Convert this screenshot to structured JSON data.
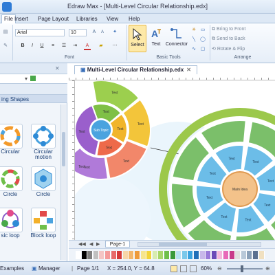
{
  "window": {
    "title": "Edraw Max - [Multi-Level Circular Relationship.edx]"
  },
  "tabs": [
    "File",
    "Insert",
    "Page Layout",
    "Libraries",
    "View",
    "Help"
  ],
  "ribbon": {
    "font_name": "Arial",
    "font_size": "10",
    "groups": {
      "font": "Font",
      "basic_tools": "Basic Tools",
      "arrange": "Arrange"
    },
    "tools": {
      "select": "Select",
      "text": "Text",
      "connector": "Connector"
    },
    "arrange_items": [
      "Bring to Front",
      "Send to Back",
      "Rotate & Flip"
    ],
    "font_buttons": [
      "B",
      "I",
      "U",
      "A"
    ]
  },
  "left_panel": {
    "section_title": "ing Shapes",
    "shapes": [
      "Circular",
      "Circular motion",
      "Circle",
      "Circle",
      "sic loop",
      "Block loop"
    ]
  },
  "document": {
    "tab_title": "Multi-Level Circular Relationship.edx",
    "page_tab": "Page-1"
  },
  "diagram_left": {
    "center_label": "Sub Topic",
    "sector_labels": [
      "Text",
      "Text",
      "Text",
      "Text",
      "Text",
      "Text",
      "Text",
      "Text",
      "Text"
    ]
  },
  "diagram_right": {
    "center_label": "Main Idea",
    "sector_labels": [
      "Text",
      "Text",
      "Text",
      "Text",
      "Text",
      "Text",
      "Text",
      "Text"
    ]
  },
  "statusbar": {
    "examples": "Examples",
    "manager": "Manager",
    "page": "Page 1/1",
    "coords": "X = 254.0, Y = 64.8",
    "zoom": "60%"
  },
  "colors": {
    "accent": "#2e7bd6",
    "green_ring": "#9cc84b",
    "green_sector": "#7bbf6a",
    "blue_sector": "#5fb3e6",
    "orange_center": "#f0b070"
  }
}
